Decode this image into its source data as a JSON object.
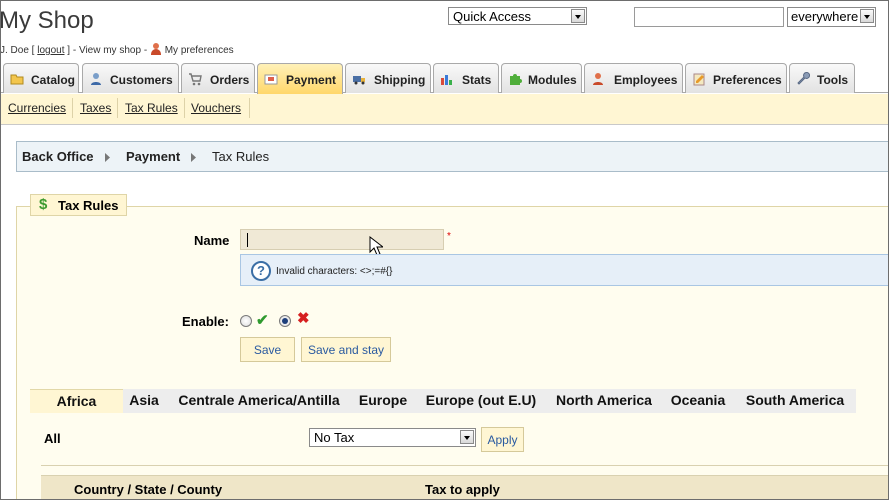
{
  "header": {
    "shop_title": "My Shop",
    "user_name": "J. Doe [",
    "logout": "logout",
    "after_logout": "] -",
    "view_shop": "View my shop",
    "sep": "-",
    "preferences": "My preferences",
    "quick_access": "Quick Access",
    "search_value": "",
    "search_scope": "everywhere"
  },
  "tabs": [
    {
      "label": "Catalog",
      "icon": "folder-icon"
    },
    {
      "label": "Customers",
      "icon": "customer-icon"
    },
    {
      "label": "Orders",
      "icon": "cart-icon"
    },
    {
      "label": "Payment",
      "icon": "payment-icon",
      "active": true
    },
    {
      "label": "Shipping",
      "icon": "truck-icon"
    },
    {
      "label": "Stats",
      "icon": "chart-icon"
    },
    {
      "label": "Modules",
      "icon": "puzzle-icon"
    },
    {
      "label": "Employees",
      "icon": "employee-icon"
    },
    {
      "label": "Preferences",
      "icon": "preferences-icon"
    },
    {
      "label": "Tools",
      "icon": "wrench-icon"
    }
  ],
  "subtabs": [
    "Currencies",
    "Taxes",
    "Tax Rules",
    "Vouchers"
  ],
  "breadcrumb": [
    "Back Office",
    "Payment",
    "Tax Rules"
  ],
  "form": {
    "legend": "Tax Rules",
    "name_label": "Name",
    "name_value": "",
    "required_mark": "*",
    "hint": "Invalid characters: <>;=#{}",
    "enable_label": "Enable:",
    "save": "Save",
    "save_and_stay": "Save and stay"
  },
  "zones": [
    "Africa",
    "Asia",
    "Centrale America/Antilla",
    "Europe",
    "Europe (out E.U)",
    "North America",
    "Oceania",
    "South America"
  ],
  "zone_panel": {
    "all_label": "All",
    "tax_selected": "No Tax",
    "apply": "Apply",
    "col_country": "Country / State / County",
    "col_tax": "Tax to apply"
  },
  "colors": {
    "active_tab": "#ffd76a",
    "subtab_bg": "#fff6d3",
    "breadcrumb_bg": "#edf3f7",
    "button_text": "#2a5aa0",
    "hint_bg": "#e6eff8"
  }
}
